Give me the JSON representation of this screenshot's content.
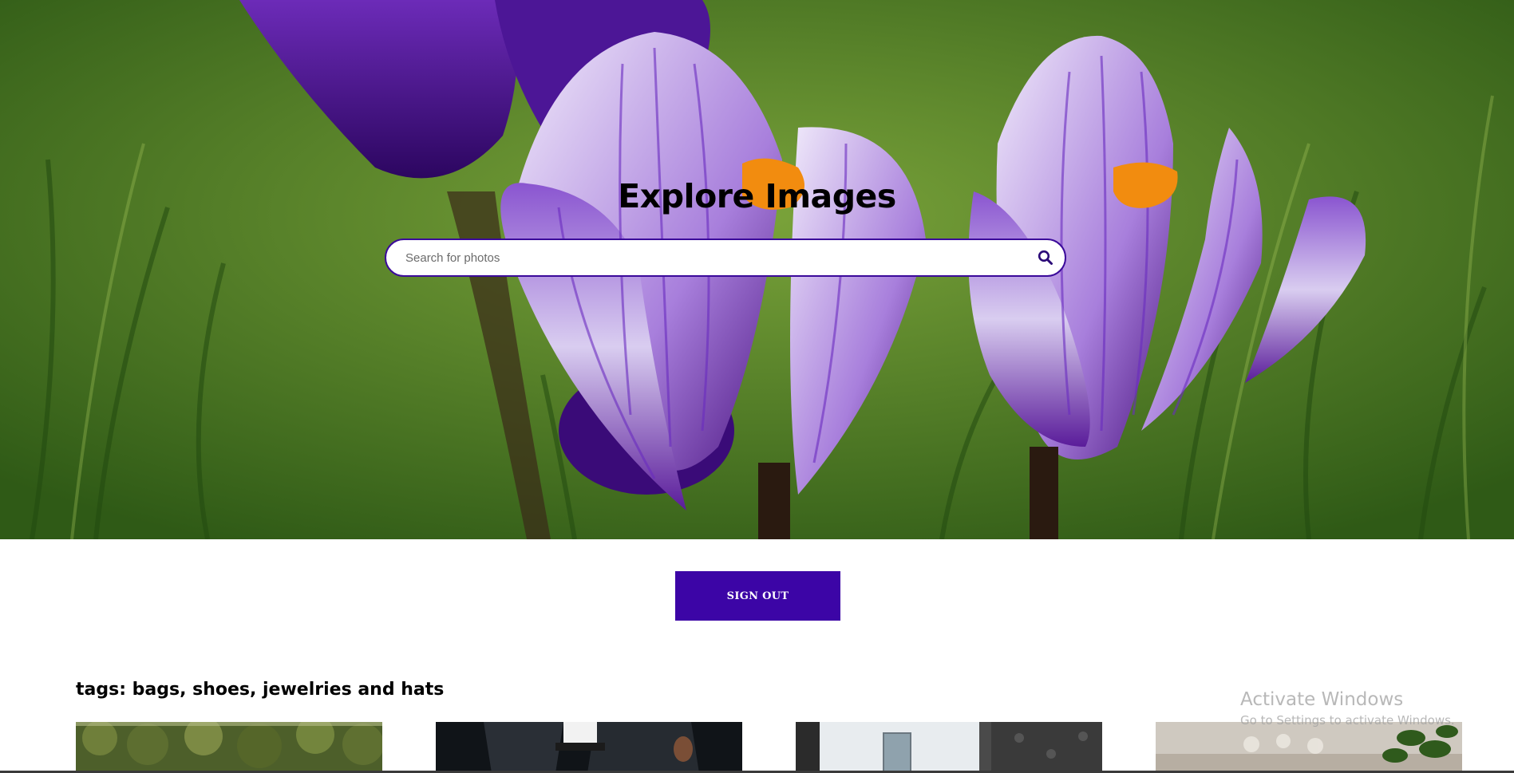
{
  "hero": {
    "title": "Explore Images",
    "search": {
      "placeholder": "Search for photos",
      "value": ""
    }
  },
  "actions": {
    "sign_out_label": "SIGN OUT"
  },
  "gallery": {
    "tags_heading": "tags: bags, shoes, jewelries and hats",
    "items": [
      {
        "icon": "photo-garden-hedge"
      },
      {
        "icon": "photo-person-in-suit"
      },
      {
        "icon": "photo-building-window"
      },
      {
        "icon": "photo-interior-plant"
      }
    ]
  },
  "system_watermark": {
    "title": "Activate Windows",
    "subtitle": "Go to Settings to activate Windows."
  },
  "colors": {
    "accent": "#3c05a6",
    "search_border": "#3b0a9a",
    "background": "#ffffff"
  }
}
